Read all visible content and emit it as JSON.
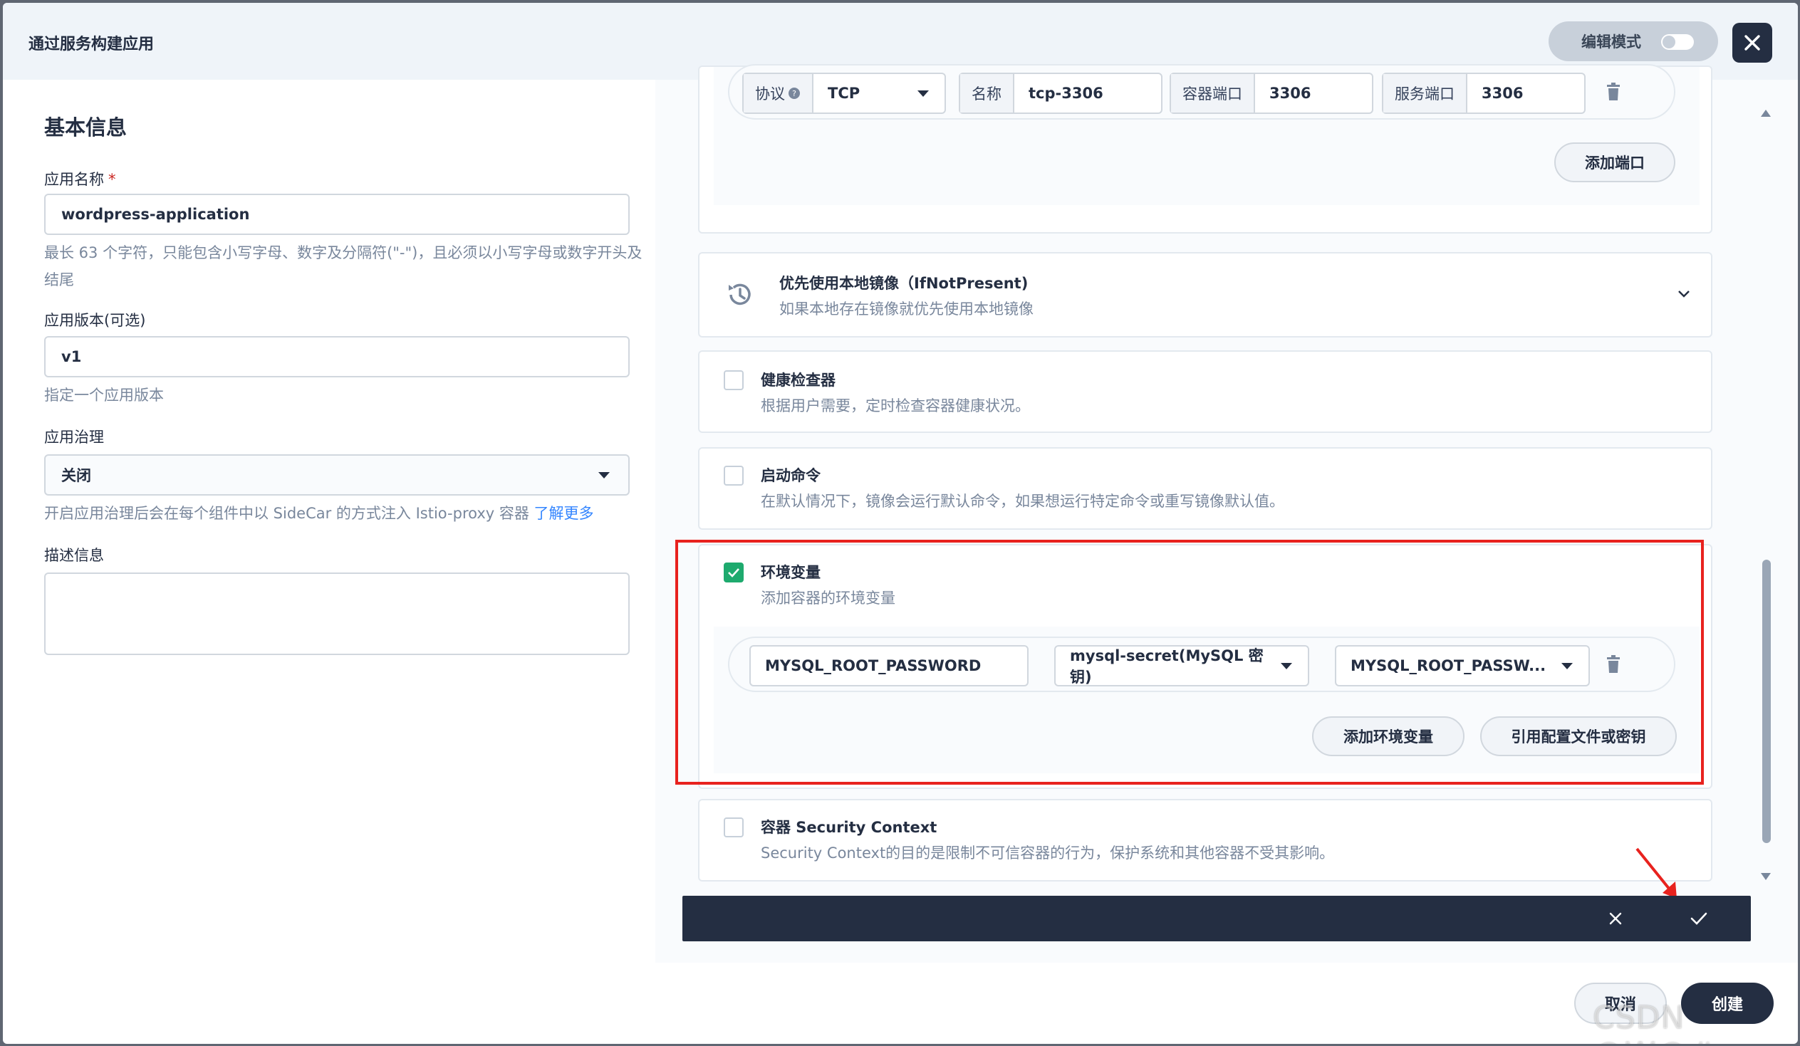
{
  "modal": {
    "title": "通过服务构建应用",
    "edit_mode_label": "编辑模式"
  },
  "basic_info": {
    "section_title": "基本信息",
    "app_name_label": "应用名称",
    "app_name_required": "*",
    "app_name_value": "wordpress-application",
    "app_name_hint": "最长 63 个字符，只能包含小写字母、数字及分隔符(\"-\")，且必须以小写字母或数字开头及结尾",
    "version_label": "应用版本(可选)",
    "version_value": "v1",
    "version_hint": "指定一个应用版本",
    "governance_label": "应用治理",
    "governance_value": "关闭",
    "governance_hint": "开启应用治理后会在每个组件中以 SideCar 的方式注入 Istio-proxy 容器",
    "governance_link": "了解更多",
    "description_label": "描述信息",
    "description_value": ""
  },
  "ports": {
    "protocol_label": "协议",
    "protocol_value": "TCP",
    "name_label": "名称",
    "name_value": "tcp-3306",
    "container_port_label": "容器端口",
    "container_port_value": "3306",
    "service_port_label": "服务端口",
    "service_port_value": "3306",
    "add_port_button": "添加端口"
  },
  "image_pull": {
    "title": "优先使用本地镜像（IfNotPresent)",
    "desc": "如果本地存在镜像就优先使用本地镜像"
  },
  "health_check": {
    "title": "健康检查器",
    "desc": "根据用户需要，定时检查容器健康状况。",
    "checked": false
  },
  "start_command": {
    "title": "启动命令",
    "desc": "在默认情况下，镜像会运行默认命令，如果想运行特定命令或重写镜像默认值。",
    "checked": false
  },
  "env_vars": {
    "title": "环境变量",
    "desc": "添加容器的环境变量",
    "checked": true,
    "key_value": "MYSQL_ROOT_PASSWORD",
    "secret_value": "mysql-secret(MySQL 密钥)",
    "secret_key_value": "MYSQL_ROOT_PASSW...",
    "add_env_button": "添加环境变量",
    "ref_config_button": "引用配置文件或密钥"
  },
  "security_context": {
    "title": "容器 Security Context",
    "desc": "Security Context的目的是限制不可信容器的行为，保护系统和其他容器不受其影响。",
    "checked": false
  },
  "footer": {
    "cancel_button": "取消",
    "create_button": "创建"
  },
  "watermark": "CSDN @W@#",
  "colors": {
    "accent_green": "#1eaa6e",
    "highlight_red": "#e8221e",
    "dark_bar": "#242e42",
    "link_blue": "#3385ff"
  }
}
